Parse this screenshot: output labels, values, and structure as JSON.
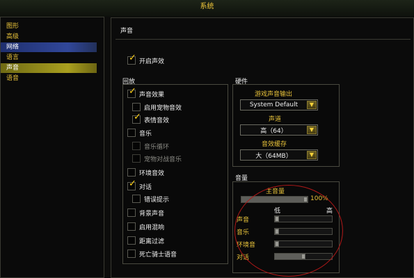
{
  "window": {
    "title": "系统"
  },
  "menu": {
    "items": [
      "图形",
      "高级",
      "网络",
      "语言",
      "声音",
      "语音"
    ]
  },
  "sound": {
    "section_title": "声音",
    "enable_sound": "开启声效",
    "playback": {
      "title": "回放",
      "items": [
        {
          "label": "声音效果",
          "checked": true,
          "enabled": true
        },
        {
          "label": "启用宠物音效",
          "checked": false,
          "enabled": true
        },
        {
          "label": "表情音效",
          "checked": true,
          "enabled": true
        },
        {
          "label": "音乐",
          "checked": false,
          "enabled": true
        },
        {
          "label": "音乐循环",
          "checked": false,
          "enabled": false
        },
        {
          "label": "宠物对战音乐",
          "checked": false,
          "enabled": false
        },
        {
          "label": "环境音效",
          "checked": false,
          "enabled": true
        },
        {
          "label": "对话",
          "checked": true,
          "enabled": true
        },
        {
          "label": "错误提示",
          "checked": false,
          "enabled": true
        },
        {
          "label": "背景声音",
          "checked": false,
          "enabled": true
        },
        {
          "label": "启用混响",
          "checked": false,
          "enabled": true
        },
        {
          "label": "距离过滤",
          "checked": false,
          "enabled": true
        },
        {
          "label": "死亡骑士语音",
          "checked": false,
          "enabled": true
        }
      ]
    },
    "hardware": {
      "title": "硬件",
      "output_label": "游戏声音输出",
      "output_value": "System Default",
      "channels_label": "声道",
      "channels_value": "高（64）",
      "cache_label": "音效缓存",
      "cache_value": "大（64MB）"
    },
    "volume": {
      "title": "音量",
      "master_label": "主音量",
      "master_value": "100%",
      "master_level": 1.0,
      "low_label": "低",
      "high_label": "高",
      "sliders": [
        {
          "label": "声音",
          "level": 0.0
        },
        {
          "label": "音乐",
          "level": 0.0
        },
        {
          "label": "环境音",
          "level": 0.0
        },
        {
          "label": "对话",
          "level": 0.5
        }
      ]
    }
  }
}
